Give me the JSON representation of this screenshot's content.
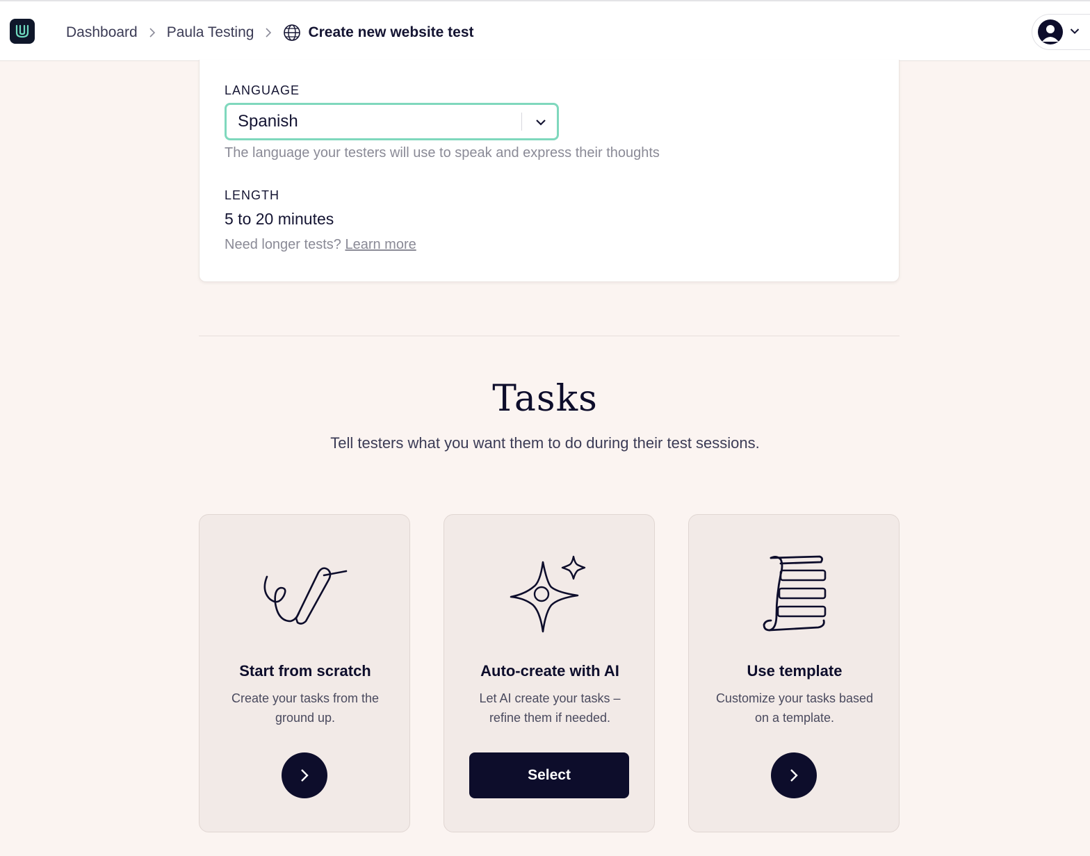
{
  "header": {
    "breadcrumb": [
      {
        "label": "Dashboard"
      },
      {
        "label": "Paula Testing"
      }
    ],
    "current_page": "Create new website test",
    "logo_icon": "usertesting-logo-icon",
    "globe_icon": "globe-icon",
    "user_icon": "user-avatar-icon"
  },
  "settings": {
    "language_label": "LANGUAGE",
    "language_value": "Spanish",
    "language_helper": "The language your testers will use to speak and express their thoughts",
    "length_label": "LENGTH",
    "length_value": "5 to 20 minutes",
    "length_helper": "Need longer tests?",
    "length_link": "Learn more"
  },
  "tasks": {
    "title": "Tasks",
    "subtitle": "Tell testers what you want them to do during their test sessions.",
    "options": [
      {
        "title": "Start from scratch",
        "description": "Create your tasks from the ground up.",
        "icon": "pen-scribble-icon"
      },
      {
        "title": "Auto-create with AI",
        "description": "Let AI create your tasks – refine them if needed.",
        "icon": "sparkle-icon",
        "button_label": "Select"
      },
      {
        "title": "Use template",
        "description": "Customize your tasks based on a template.",
        "icon": "scroll-template-icon"
      }
    ]
  },
  "colors": {
    "accent_focus": "#7fd8bd",
    "navy": "#0d0d2b",
    "page_bg": "#fbf4f1",
    "card_bg": "#f2eae7"
  }
}
